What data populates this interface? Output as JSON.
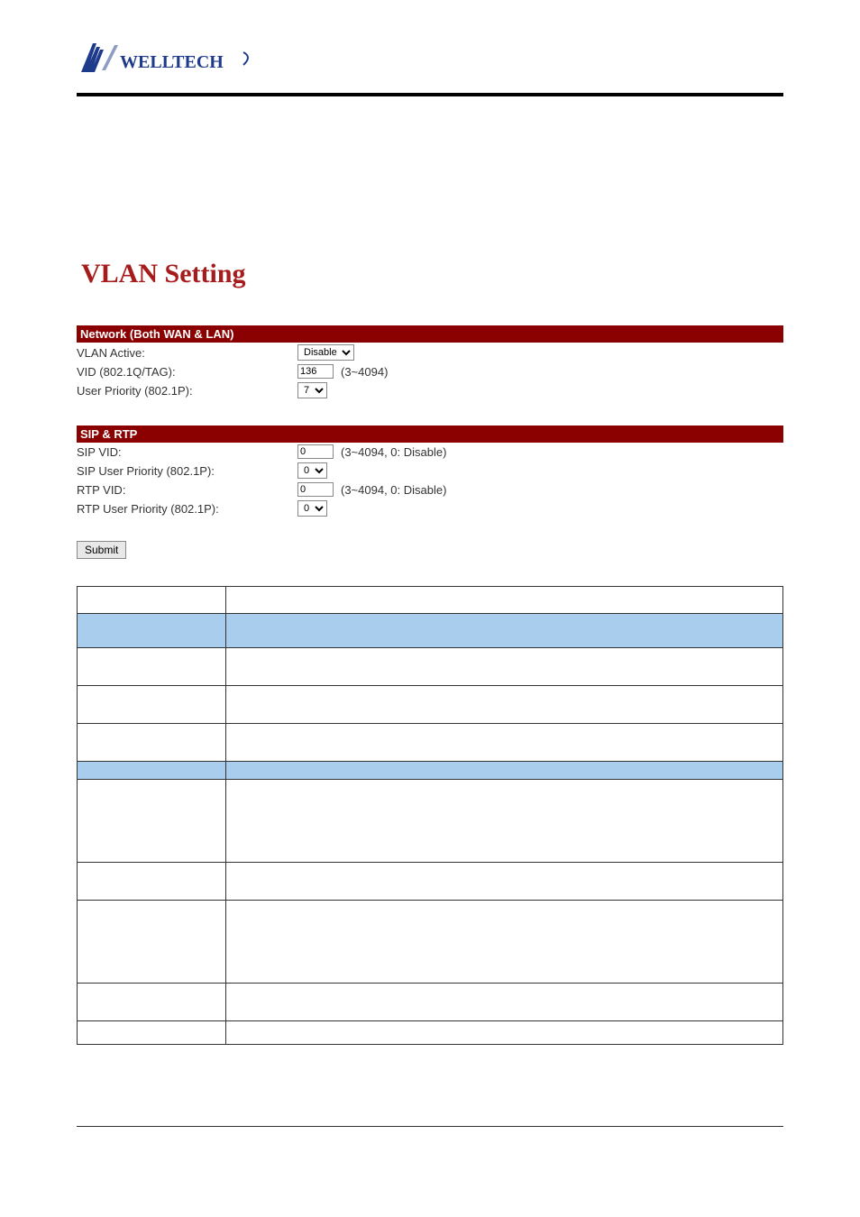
{
  "logo_text": "WELLTECH",
  "title": "VLAN Setting",
  "section_network": {
    "header": "Network (Both WAN & LAN)",
    "vlan_active_label": "VLAN Active:",
    "vlan_active_value": "Disable",
    "vid_label": "VID (802.1Q/TAG):",
    "vid_value": "136",
    "vid_hint": "(3~4094)",
    "user_priority_label": "User Priority (802.1P):",
    "user_priority_value": "7"
  },
  "section_siprtp": {
    "header": "SIP & RTP",
    "sip_vid_label": "SIP VID:",
    "sip_vid_value": "0",
    "sip_vid_hint": "(3~4094, 0: Disable)",
    "sip_priority_label": "SIP User Priority (802.1P):",
    "sip_priority_value": "0",
    "rtp_vid_label": "RTP VID:",
    "rtp_vid_value": "0",
    "rtp_vid_hint": "(3~4094, 0: Disable)",
    "rtp_priority_label": "RTP User Priority (802.1P):",
    "rtp_priority_value": "0"
  },
  "submit_label": "Submit"
}
